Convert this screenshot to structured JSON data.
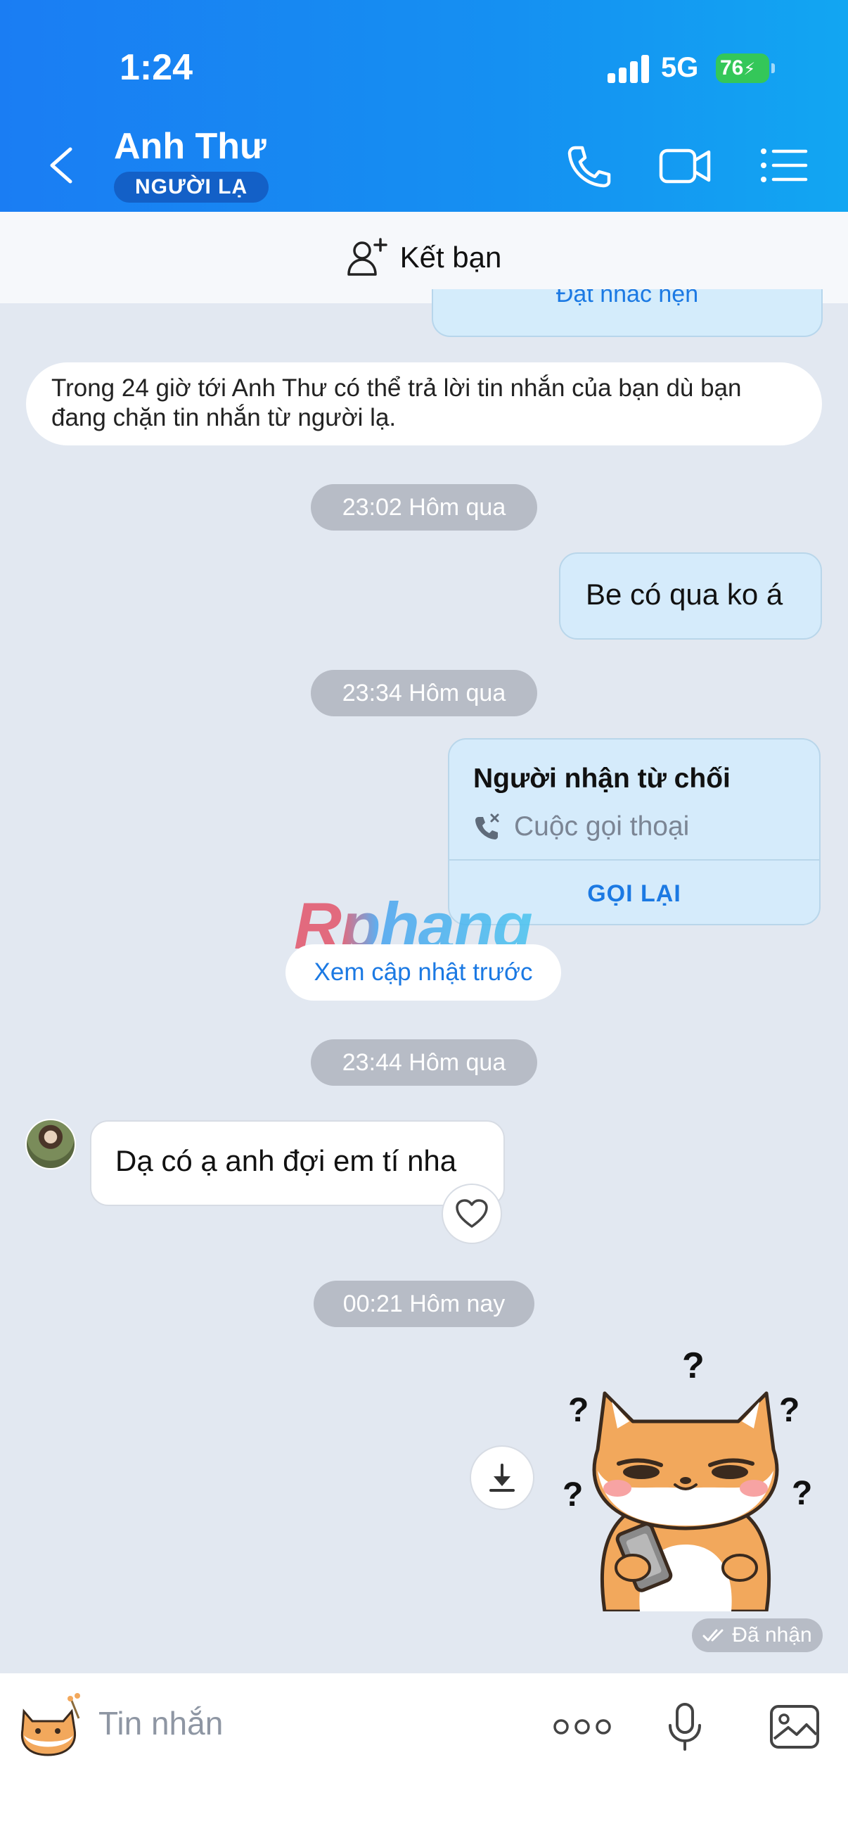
{
  "status_bar": {
    "time": "1:24",
    "network": "5G",
    "battery": "76"
  },
  "header": {
    "title": "Anh Thư",
    "badge": "NGƯỜI LẠ",
    "icons": [
      "back-chevron-icon",
      "phone-icon",
      "video-call-icon",
      "list-menu-icon"
    ]
  },
  "friend_bar": {
    "label": "Kết bạn",
    "icon": "add-friend-icon"
  },
  "chat": {
    "reminder_button": "Đặt nhắc hẹn",
    "notice": "Trong 24 giờ tới Anh Thư có thể trả lời tin nhắn của bạn dù bạn đang chặn tin nhắn từ người lạ.",
    "time_1": "23:02 Hôm qua",
    "out_message_1": "Be có qua ko á",
    "time_2": "23:34 Hôm qua",
    "call_card": {
      "title": "Người nhận từ chối",
      "subtitle": "Cuộc gọi thoại",
      "action": "GỌI LẠI"
    },
    "watermark": "Rphang",
    "prev_updates": "Xem cập nhật trước",
    "time_3": "23:44 Hôm qua",
    "in_message_1": "Dạ có ạ anh đợi em tí nha",
    "time_4": "00:21 Hôm nay",
    "received_status": "Đã nhận"
  },
  "input_bar": {
    "placeholder": "Tin nhắn",
    "icons": [
      "sticker-icon",
      "more-icon",
      "microphone-icon",
      "image-icon"
    ]
  },
  "colors": {
    "header_blue": "#1a7df3",
    "accent_blue": "#1b79e3",
    "chat_background": "#e2e8f1",
    "outgoing_bubble": "#d5ebfb",
    "battery_green": "#34c759"
  }
}
